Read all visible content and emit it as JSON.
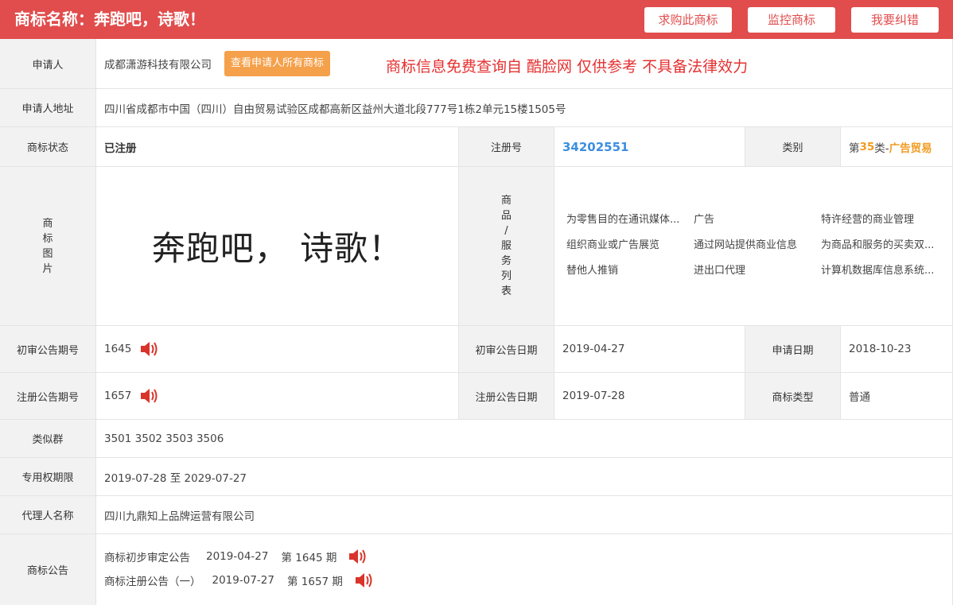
{
  "header": {
    "title": "商标名称：奔跑吧，诗歌！",
    "buttons": [
      "求购此商标",
      "监控商标",
      "我要纠错"
    ]
  },
  "applicant": {
    "label": "申请人",
    "value": "成都潇游科技有限公司",
    "button": "查看申请人所有商标",
    "notice": "商标信息免费查询自 酷脸网 仅供参考  不具备法律效力"
  },
  "address": {
    "label": "申请人地址",
    "value": "四川省成都市中国（四川）自由贸易试验区成都高新区益州大道北段777号1栋2单元15楼1505号"
  },
  "status": {
    "label": "商标状态",
    "value": "已注册",
    "reg_label": "注册号",
    "reg_no": "34202551",
    "class_label": "类别",
    "class_prefix": "第",
    "class_num": "35",
    "class_suffix": "类-",
    "class_name": "广告贸易"
  },
  "image": {
    "label_chars": [
      "商",
      "标",
      "图",
      "片"
    ],
    "text": "奔跑吧， 诗歌！"
  },
  "goods": {
    "label_chars": [
      "商",
      "品",
      "/",
      "服",
      "务",
      "列",
      "表"
    ],
    "items": [
      "为零售目的在通讯媒体上展示商品",
      "广告",
      "特许经营的商业管理",
      "组织商业或广告展览",
      "通过网站提供商业信息",
      "为商品和服务的买卖双方提供在线市场",
      "替他人推销",
      "进出口代理",
      "计算机数据库信息系统化"
    ]
  },
  "prelim": {
    "label": "初审公告期号",
    "value": "1645",
    "date_label": "初审公告日期",
    "date": "2019-04-27",
    "apply_label": "申请日期",
    "apply_date": "2018-10-23"
  },
  "reg_notice": {
    "label": "注册公告期号",
    "value": "1657",
    "date_label": "注册公告日期",
    "date": "2019-07-28",
    "type_label": "商标类型",
    "type": "普通"
  },
  "similar": {
    "label": "类似群",
    "value": "3501 3502 3503 3506"
  },
  "term": {
    "label": "专用权期限",
    "value": "2019-07-28 至 2029-07-27"
  },
  "agent": {
    "label": "代理人名称",
    "value": "四川九鼎知上品牌运营有限公司"
  },
  "announcements": {
    "label": "商标公告",
    "items": [
      {
        "name": "商标初步审定公告",
        "date": "2019-04-27",
        "issue": "第 1645 期"
      },
      {
        "name": "商标注册公告（一）",
        "date": "2019-07-27",
        "issue": "第 1657 期"
      }
    ]
  },
  "colors": {
    "header": "#e14c4c",
    "accent_orange": "#f5a04a",
    "reg_blue": "#3c8ee0",
    "speaker_red": "#d9342b"
  }
}
